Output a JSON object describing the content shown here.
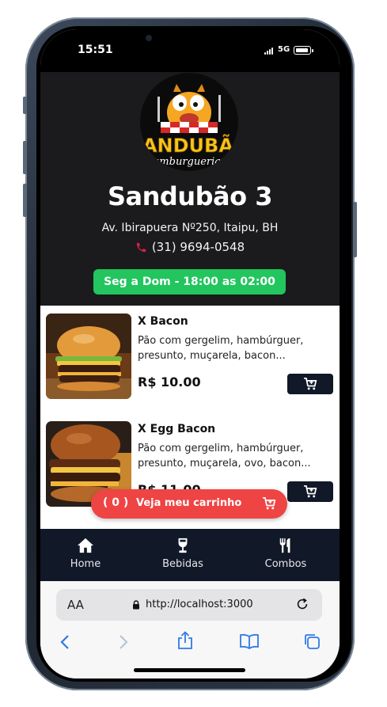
{
  "status": {
    "time": "15:51",
    "network": "5G"
  },
  "shop": {
    "logo_alt": "Sandubão Hamburgueria e Pizzaria logo",
    "logo_text": "SANDUBÃO",
    "logo_subtext": "Hamburgueria e P",
    "name": "Sandubão 3",
    "address": "Av. Ibirapuera Nº250, Itaipu, BH",
    "phone": "(31) 9694-0548",
    "hours": "Seg a Dom - 18:00 as 02:00"
  },
  "menu": {
    "items": [
      {
        "name": "X Bacon",
        "desc_line1": "Pão com gergelim, hambúrguer,",
        "desc_line2": "presunto, muçarela, bacon...",
        "price": "R$ 10.00",
        "image": "burger-bacon"
      },
      {
        "name": "X Egg Bacon",
        "desc_line1": "Pão com gergelim, hambúrguer,",
        "desc_line2": "presunto, muçarela, ovo, bacon...",
        "price": "R$ 11.00",
        "image": "burger-egg-bacon"
      }
    ]
  },
  "cart": {
    "count": "( 0 )",
    "label": "Veja meu carrinho"
  },
  "tabs": [
    {
      "label": "Home",
      "icon": "home-icon"
    },
    {
      "label": "Bebidas",
      "icon": "wine-glass-icon"
    },
    {
      "label": "Combos",
      "icon": "utensils-icon"
    }
  ],
  "browser": {
    "text_size": "AA",
    "url": "http://localhost:3000"
  },
  "colors": {
    "header_bg": "#1b1b1d",
    "hours_green": "#22c55e",
    "cart_red": "#ef4444",
    "navy": "#111827",
    "phone_red": "#e11d48"
  }
}
